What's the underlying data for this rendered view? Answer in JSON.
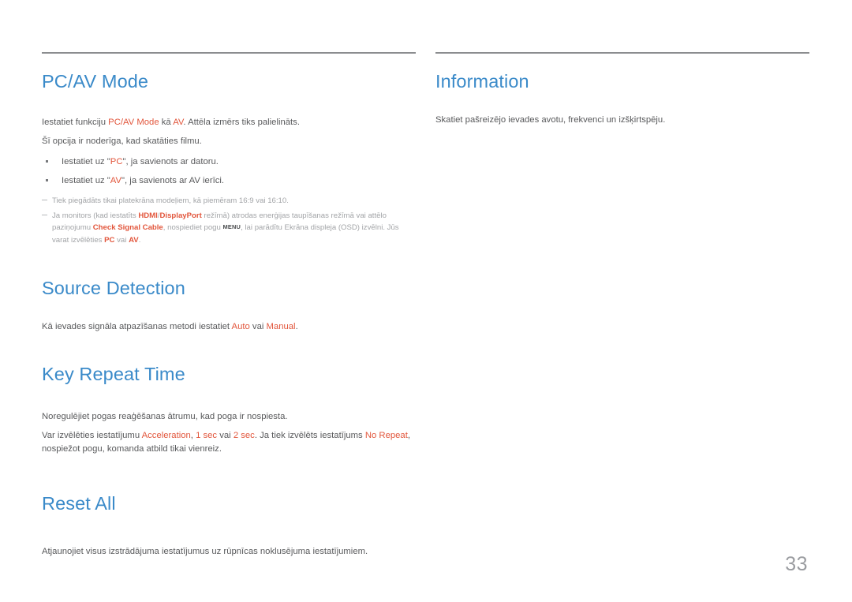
{
  "document": {
    "page_number": "33",
    "accent_heading_color": "#3a8ac9",
    "highlight_color": "#e2563c",
    "body_text_color": "#58595b",
    "note_text_color": "#a2a4a7",
    "rule_color": "#8b8d8f"
  },
  "left_column": {
    "sections": [
      {
        "id": "pc-av-mode",
        "heading": "PC/AV Mode",
        "paragraph_1": {
          "part_1": "Iestatiet funkciju ",
          "term_1": "PC/AV Mode",
          "part_2": " kā ",
          "term_2": "AV",
          "part_3": ". Attēla izmērs tiks palielināts."
        },
        "paragraph_2": "Šī opcija ir noderīga, kad skatāties filmu.",
        "bullets": [
          {
            "part_1": "Iestatiet uz \"",
            "term": "PC",
            "part_2": "\", ja savienots ar datoru."
          },
          {
            "part_1": "Iestatiet uz \"",
            "term": "AV",
            "part_2": "\", ja savienots ar AV ierīci."
          }
        ],
        "notes": [
          {
            "text": "Tiek piegādāts tikai platekrāna modeļiem, kā piemēram 16:9 vai 16:10."
          },
          {
            "p1": "Ja monitors (kad iestatīts ",
            "t1": "HDMI",
            "slash": "/",
            "t2": "DisplayPort",
            "p2": " režīmā) atrodas enerģijas taupīšanas režīmā vai attēlo paziņojumu ",
            "t3": "Check Signal Cable",
            "p3": ", nospiediet pogu ",
            "key": "MENU",
            "p4": ", lai parādītu Ekrāna displeja (OSD) izvēlni. Jūs varat izvēlēties ",
            "t4": "PC",
            "p5": " vai ",
            "t5": "AV",
            "p6": "."
          }
        ]
      },
      {
        "id": "source-detection",
        "heading": "Source Detection",
        "paragraph_1": {
          "part_1": "Kā ievades signāla atpazīšanas metodi iestatiet ",
          "term_1": "Auto",
          "part_2": " vai ",
          "term_2": "Manual",
          "part_3": "."
        }
      },
      {
        "id": "key-repeat-time",
        "heading": "Key Repeat Time",
        "paragraph_1": "Noregulējiet pogas reaģēšanas ātrumu, kad poga ir nospiesta.",
        "paragraph_2": {
          "part_1": "Var izvēlēties iestatījumu ",
          "term_1": "Acceleration",
          "part_2": ", ",
          "term_2": "1 sec",
          "part_3": " vai ",
          "term_3": "2 sec",
          "part_4": ". Ja tiek izvēlēts iestatījums ",
          "term_4": "No Repeat",
          "part_5": ", nospiežot pogu, komanda atbild tikai vienreiz."
        }
      },
      {
        "id": "reset-all",
        "heading": "Reset All",
        "paragraph_1": "Atjaunojiet visus izstrādājuma iestatījumus uz rūpnīcas noklusējuma iestatījumiem."
      }
    ]
  },
  "right_column": {
    "sections": [
      {
        "id": "information",
        "heading": "Information",
        "paragraph_1": "Skatiet pašreizējo ievades avotu, frekvenci un izšķirtspēju."
      }
    ]
  }
}
